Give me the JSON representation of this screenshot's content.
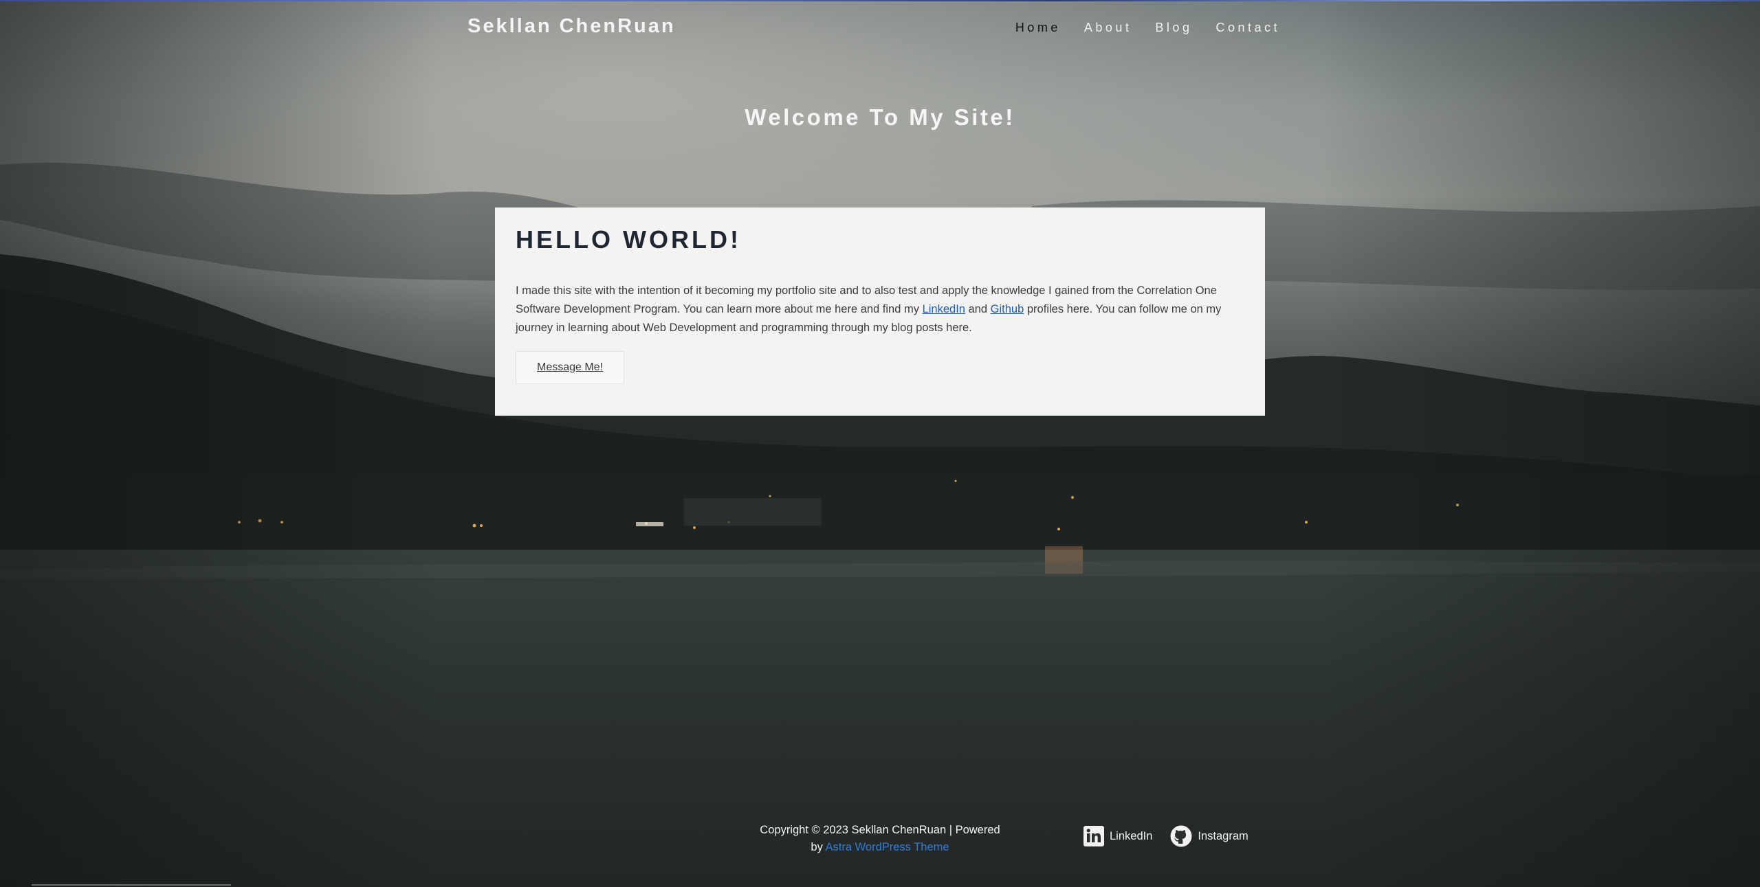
{
  "header": {
    "site_title": "Sekllan ChenRuan",
    "nav": [
      {
        "label": "Home"
      },
      {
        "label": "About"
      },
      {
        "label": "Blog"
      },
      {
        "label": "Contact"
      }
    ]
  },
  "hero": {
    "title": "Welcome To My Site!"
  },
  "card": {
    "heading": "HELLO WORLD!",
    "text_part1": "I made this site with the intention of it becoming my portfolio site and to also test and apply the knowledge I gained from the Correlation One Software Development Program. You can learn more about me here and find my ",
    "linkedin_link": "LinkedIn",
    "text_and": " and ",
    "github_link": "Github",
    "text_part2": " profiles here. You can follow me on my journey in learning about Web Development and programming through my blog posts here.",
    "button_label": "Message Me!"
  },
  "footer": {
    "copyright_line1": "Copyright © 2023 Sekllan ChenRuan | Powered",
    "copyright_by": "by ",
    "theme_link": "Astra WordPress Theme",
    "social": [
      {
        "label": "LinkedIn",
        "icon": "linkedin-icon"
      },
      {
        "label": "Instagram",
        "icon": "github-icon"
      }
    ]
  },
  "colors": {
    "card_background": "#f3f3f3",
    "link": "#1a5fb4",
    "footer_link": "#2f7bd8",
    "heading": "#1f2633"
  }
}
